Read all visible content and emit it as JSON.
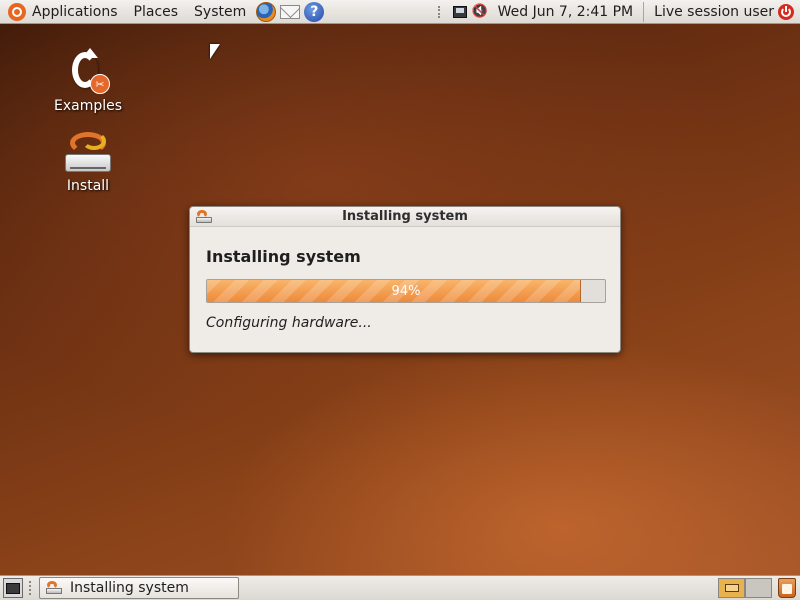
{
  "top_panel": {
    "menus": {
      "applications": "Applications",
      "places": "Places",
      "system": "System"
    },
    "clock": "Wed Jun  7,  2:41 PM",
    "user": "Live session user",
    "help_glyph": "?"
  },
  "desktop": {
    "icons": [
      {
        "label": "Examples",
        "icon": "examples-icon"
      },
      {
        "label": "Install",
        "icon": "install-icon"
      }
    ],
    "examples_badge_glyph": "✂"
  },
  "dialog": {
    "title": "Installing system",
    "heading": "Installing system",
    "progress": {
      "percent": 94,
      "label": "94%"
    },
    "status": "Configuring hardware..."
  },
  "bottom_panel": {
    "tasks": [
      {
        "label": "Installing system",
        "icon": "installer-icon"
      }
    ],
    "workspaces": {
      "count": 2,
      "active": 1
    }
  },
  "colors": {
    "accent_orange": "#ee8a3a",
    "panel_bg": "#dedad4",
    "dialog_bg": "#efebe7"
  }
}
